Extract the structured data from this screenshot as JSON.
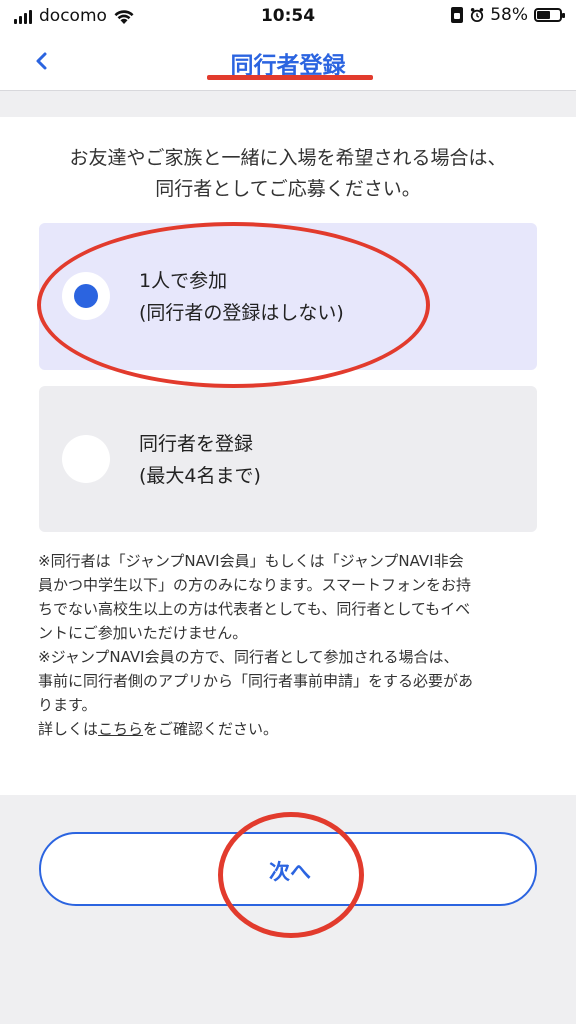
{
  "status_bar": {
    "carrier": "docomo",
    "time": "10:54",
    "battery_percent": "58%",
    "battery_level": 0.58
  },
  "nav": {
    "back_icon": "chevron-left-icon",
    "title": "同行者登録"
  },
  "intro": {
    "line1": "お友達やご家族と一緒に入場を希望される場合は、",
    "line2": "同行者としてご応募ください。"
  },
  "options": [
    {
      "line1": "1人で参加",
      "line2": "(同行者の登録はしない)",
      "selected": true
    },
    {
      "line1": "同行者を登録",
      "line2": "(最大4名まで)",
      "selected": false
    }
  ],
  "note": {
    "p1_line1": "※同行者は「ジャンプNAVI会員」もしくは「ジャンプNAVI非会",
    "p1_line2": "員かつ中学生以下」の方のみになります。スマートフォンをお持",
    "p1_line3": "ちでない高校生以上の方は代表者としても、同行者としてもイベ",
    "p1_line4": "ントにご参加いただけません。",
    "p2_line1": "※ジャンプNAVI会員の方で、同行者として参加される場合は、",
    "p2_line2": "事前に同行者側のアプリから「同行者事前申請」をする必要があ",
    "p2_line3": "ります。",
    "p3_prefix": "詳しくは",
    "p3_link": "こちら",
    "p3_suffix": "をご確認ください。"
  },
  "footer": {
    "next_label": "次へ"
  },
  "colors": {
    "accent": "#2b64e0",
    "annotation": "#e23b2d",
    "selected_bg": "#e7e7fb",
    "unselected_bg": "#ededf0"
  }
}
